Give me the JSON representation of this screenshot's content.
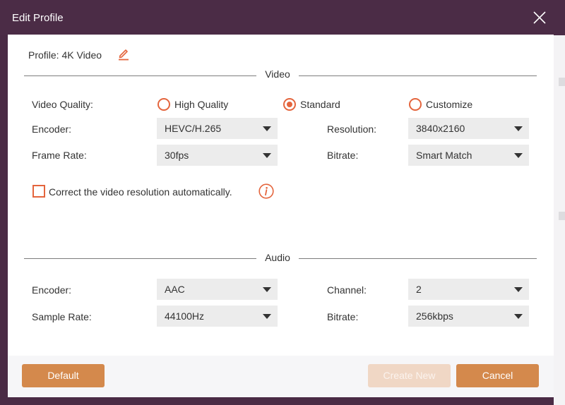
{
  "window": {
    "title": "Edit Profile"
  },
  "profile": {
    "label": "Profile:",
    "name": "4K Video"
  },
  "video": {
    "section_label": "Video",
    "quality_label": "Video Quality:",
    "quality_options": [
      "High Quality",
      "Standard",
      "Customize"
    ],
    "quality_selected": "Standard",
    "encoder_label": "Encoder:",
    "encoder_value": "HEVC/H.265",
    "resolution_label": "Resolution:",
    "resolution_value": "3840x2160",
    "framerate_label": "Frame Rate:",
    "framerate_value": "30fps",
    "bitrate_label": "Bitrate:",
    "bitrate_value": "Smart Match",
    "auto_correct_label": "Correct the video resolution automatically.",
    "auto_correct_checked": false
  },
  "audio": {
    "section_label": "Audio",
    "encoder_label": "Encoder:",
    "encoder_value": "AAC",
    "channel_label": "Channel:",
    "channel_value": "2",
    "samplerate_label": "Sample Rate:",
    "samplerate_value": "44100Hz",
    "bitrate_label": "Bitrate:",
    "bitrate_value": "256kbps"
  },
  "buttons": {
    "default": "Default",
    "create_new": "Create New",
    "cancel": "Cancel"
  },
  "colors": {
    "accent": "#e4653d",
    "button": "#d4894c",
    "button_disabled": "#f0d7c5",
    "titlebar": "#4b2c46"
  },
  "icons": {
    "close": "close-icon",
    "edit": "pencil-icon",
    "info": "info-icon",
    "dropdown": "chevron-down-icon"
  }
}
